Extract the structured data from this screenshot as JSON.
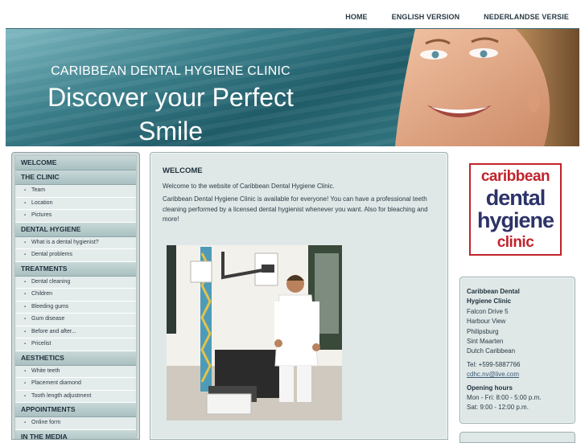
{
  "topnav": {
    "items": [
      "HOME",
      "ENGLISH VERSION",
      "NEDERLANDSE VERSIE"
    ]
  },
  "banner": {
    "clinic_name": "CARIBBEAN DENTAL HYGIENE CLINIC",
    "tagline_line1": "Discover your Perfect",
    "tagline_line2": "Smile"
  },
  "sidebar": {
    "welcome": "WELCOME",
    "the_clinic": "THE CLINIC",
    "the_clinic_items": [
      "Team",
      "Location",
      "Pictures"
    ],
    "dental_hygiene": "DENTAL HYGIENE",
    "dental_hygiene_items": [
      "What is a dental hygienist?",
      "Dental problems"
    ],
    "treatments": "TREATMENTS",
    "treatments_items": [
      "Dental cleaning",
      "Children",
      "Bleeding gums",
      "Gum disease",
      "Before and after...",
      "Pricelist"
    ],
    "aesthetics": "AESTHETICS",
    "aesthetics_items": [
      "White teeth",
      "Placement diamond",
      "Tooth length adjustment"
    ],
    "appointments": "APPOINTMENTS",
    "appointments_items": [
      "Online form"
    ],
    "in_the_media": "IN THE MEDIA"
  },
  "content": {
    "heading": "WELCOME",
    "intro": "Welcome to the website of Caribbean Dental Hygiene Clinic.",
    "body": "Caribbean Dental Hygiene Clinic is available for everyone! You can have a professional teeth cleaning performed by a licensed dental hygienist whenever you want. Also for bleaching and more!"
  },
  "logo": {
    "line1": "caribbean",
    "line2": "dental",
    "line3": "hygiene",
    "line4": "clinic"
  },
  "contact": {
    "name_line1": "Caribbean Dental",
    "name_line2": "Hygiene Clinic",
    "street": "Falcon Drive 5",
    "area": "Harbour View",
    "city": "Philipsburg",
    "region": "Sint Maarten",
    "country": "Dutch Caribbean",
    "tel": "Tel: +599-5887766",
    "email": "cdhc.nv@live.com",
    "hours_title": "Opening hours",
    "hours_weekday": "Mon - Fri: 8:00 - 5:00 p.m.",
    "hours_saturday": "Sat: 9:00 - 12:00 p.m."
  },
  "colors": {
    "accent_teal": "#1f5c68",
    "logo_red": "#c1232b",
    "logo_navy": "#2d3368"
  }
}
